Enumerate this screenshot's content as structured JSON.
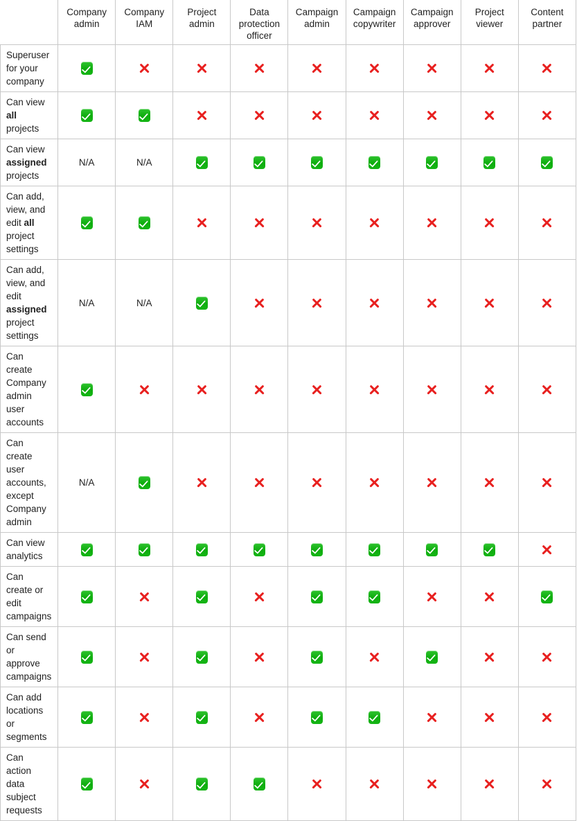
{
  "table": {
    "corner_label": "",
    "columns": [
      "Company admin",
      "Company IAM",
      "Project admin",
      "Data protection officer",
      "Campaign admin",
      "Campaign copywriter",
      "Campaign approver",
      "Project viewer",
      "Content partner"
    ],
    "icons": {
      "yes": "check-mark-button-icon",
      "no": "cross-mark-icon",
      "na": "N/A"
    },
    "rows": [
      {
        "label_html": "Superuser for your company",
        "label_text": "Superuser for your company",
        "values": [
          "yes",
          "no",
          "no",
          "no",
          "no",
          "no",
          "no",
          "no",
          "no"
        ]
      },
      {
        "label_html": "Can view <b>all</b> projects",
        "label_text": "Can view all projects",
        "values": [
          "yes",
          "yes",
          "no",
          "no",
          "no",
          "no",
          "no",
          "no",
          "no"
        ]
      },
      {
        "label_html": "Can view <b>assigned</b> projects",
        "label_text": "Can view assigned projects",
        "values": [
          "na",
          "na",
          "yes",
          "yes",
          "yes",
          "yes",
          "yes",
          "yes",
          "yes"
        ]
      },
      {
        "label_html": "Can add, view, and edit <b>all</b> project settings",
        "label_text": "Can add, view, and edit all project settings",
        "values": [
          "yes",
          "yes",
          "no",
          "no",
          "no",
          "no",
          "no",
          "no",
          "no"
        ]
      },
      {
        "label_html": "Can add, view, and edit <b>assigned</b> project settings",
        "label_text": "Can add, view, and edit assigned project settings",
        "values": [
          "na",
          "na",
          "yes",
          "no",
          "no",
          "no",
          "no",
          "no",
          "no"
        ]
      },
      {
        "label_html": "Can create Company admin user accounts",
        "label_text": "Can create Company admin user accounts",
        "values": [
          "yes",
          "no",
          "no",
          "no",
          "no",
          "no",
          "no",
          "no",
          "no"
        ]
      },
      {
        "label_html": "Can create user accounts, except Company admin",
        "label_text": "Can create user accounts, except Company admin",
        "values": [
          "na",
          "yes",
          "no",
          "no",
          "no",
          "no",
          "no",
          "no",
          "no"
        ]
      },
      {
        "label_html": "Can view analytics",
        "label_text": "Can view analytics",
        "values": [
          "yes",
          "yes",
          "yes",
          "yes",
          "yes",
          "yes",
          "yes",
          "yes",
          "no"
        ]
      },
      {
        "label_html": "Can create or edit campaigns",
        "label_text": "Can create or edit campaigns",
        "values": [
          "yes",
          "no",
          "yes",
          "no",
          "yes",
          "yes",
          "no",
          "no",
          "yes"
        ]
      },
      {
        "label_html": "Can send or approve campaigns",
        "label_text": "Can send or approve campaigns",
        "values": [
          "yes",
          "no",
          "yes",
          "no",
          "yes",
          "no",
          "yes",
          "no",
          "no"
        ]
      },
      {
        "label_html": "Can add locations or segments",
        "label_text": "Can add locations or segments",
        "values": [
          "yes",
          "no",
          "yes",
          "no",
          "yes",
          "yes",
          "no",
          "no",
          "no"
        ]
      },
      {
        "label_html": "Can action data subject requests",
        "label_text": "Can action data subject requests",
        "values": [
          "yes",
          "no",
          "yes",
          "yes",
          "no",
          "no",
          "no",
          "no",
          "no"
        ]
      }
    ]
  },
  "colors": {
    "grid_line": "#c8c8c8",
    "text": "#222222",
    "yes_green": "#16b516",
    "no_red": "#e8201f",
    "background": "#ffffff"
  }
}
